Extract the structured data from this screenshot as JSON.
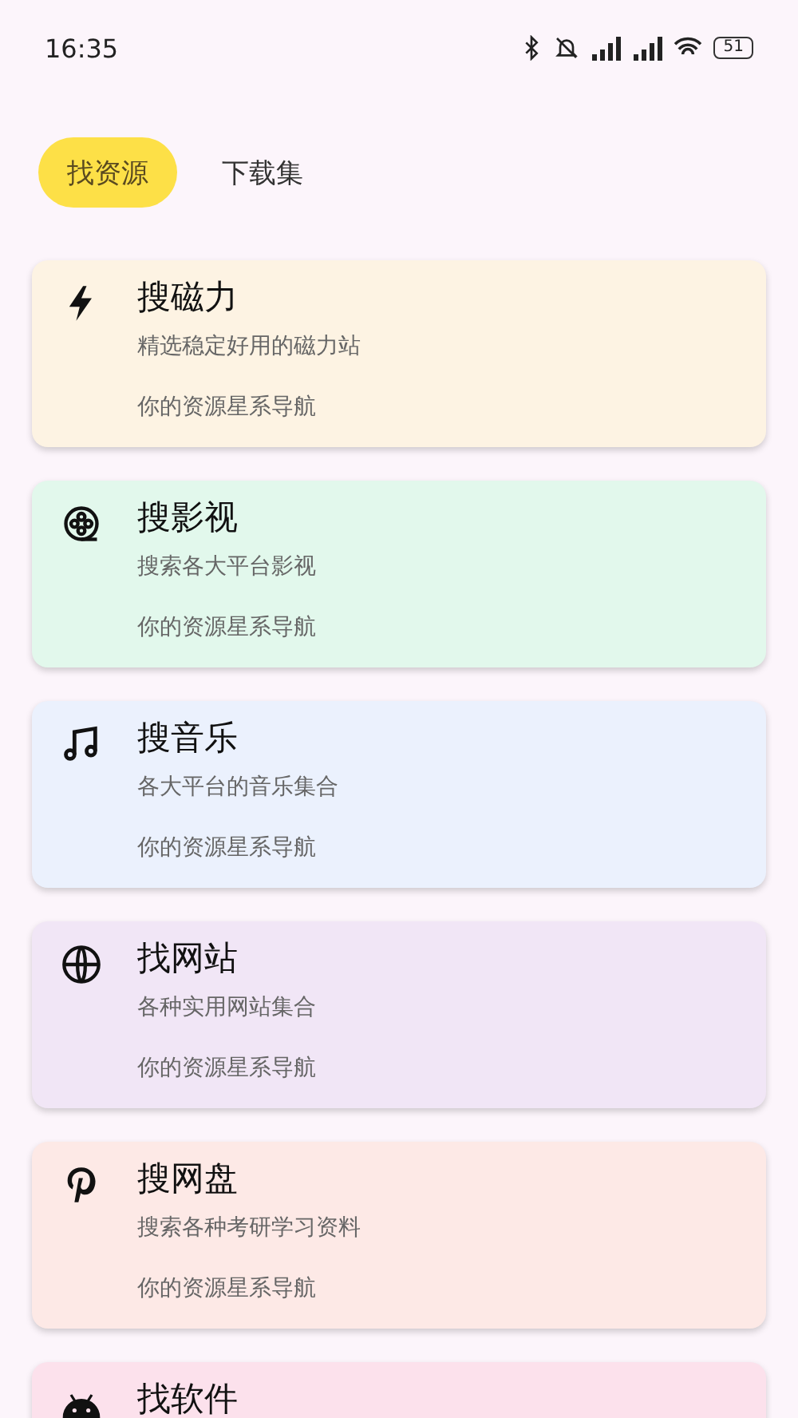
{
  "status_bar": {
    "time": "16:35",
    "battery": "51"
  },
  "tabs": [
    {
      "label": "找资源",
      "selected": true
    },
    {
      "label": "下载集",
      "selected": false
    }
  ],
  "cards": [
    {
      "color": "#fdf3e3",
      "title": "搜磁力",
      "subtitle": "精选稳定好用的磁力站",
      "footer": "你的资源星系导航"
    },
    {
      "color": "#e2f8ec",
      "title": "搜影视",
      "subtitle": "搜索各大平台影视",
      "footer": "你的资源星系导航"
    },
    {
      "color": "#ebf1fd",
      "title": "搜音乐",
      "subtitle": "各大平台的音乐集合",
      "footer": "你的资源星系导航"
    },
    {
      "color": "#f1e6f6",
      "title": "找网站",
      "subtitle": "各种实用网站集合",
      "footer": "你的资源星系导航"
    },
    {
      "color": "#fde9e6",
      "title": "搜网盘",
      "subtitle": "搜索各种考研学习资料",
      "footer": "你的资源星系导航"
    },
    {
      "color": "#fce1ec",
      "title": "找软件"
    }
  ]
}
